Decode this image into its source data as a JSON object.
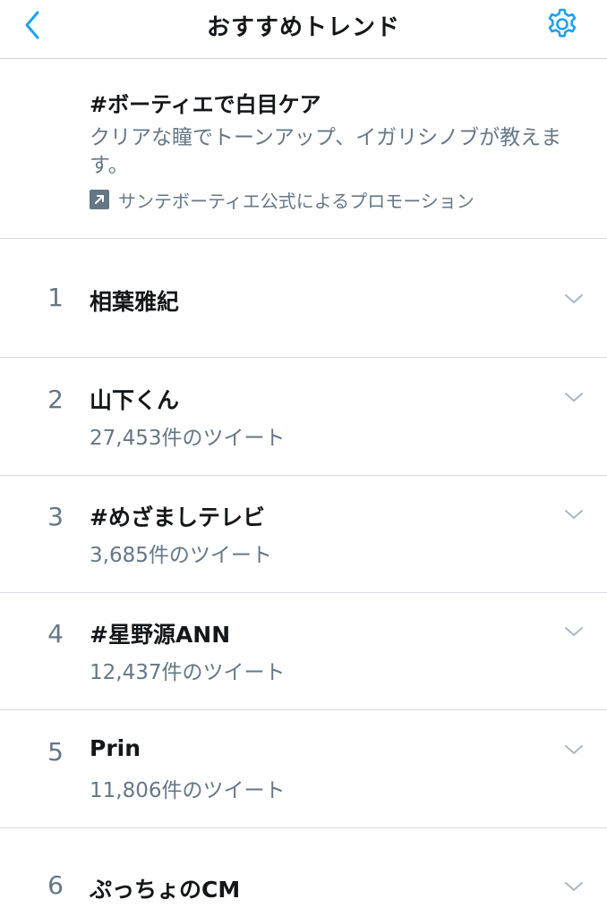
{
  "header": {
    "title": "おすすめトレンド",
    "back_icon": "chevron-left-icon",
    "settings_icon": "gear-icon",
    "accent_color": "#1da1f2"
  },
  "promoted": {
    "title": "#ボーティエで白目ケア",
    "description": "クリアな瞳でトーンアップ、イガリシノブが教えます。",
    "promoted_by": "サンテボーティエ公式によるプロモーション",
    "icon": "promoted-arrow-icon"
  },
  "trends": [
    {
      "rank": "1",
      "name": "相葉雅紀",
      "count": ""
    },
    {
      "rank": "2",
      "name": "山下くん",
      "count": "27,453件のツイート"
    },
    {
      "rank": "3",
      "name": "#めざましテレビ",
      "count": "3,685件のツイート"
    },
    {
      "rank": "4",
      "name": "#星野源ANN",
      "count": "12,437件のツイート"
    },
    {
      "rank": "5",
      "name": "Prin",
      "count": "11,806件のツイート"
    },
    {
      "rank": "6",
      "name": "ぷっちょのCM",
      "count": ""
    }
  ]
}
